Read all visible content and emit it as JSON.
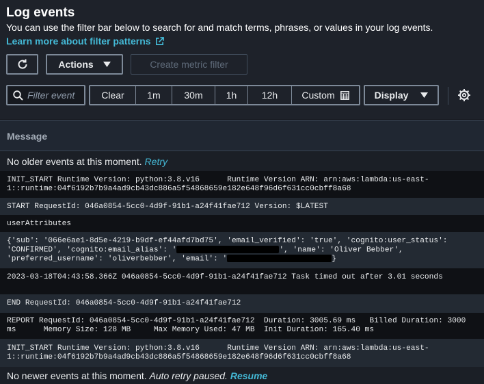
{
  "header": {
    "title": "Log events",
    "description": "You can use the filter bar below to search for and match terms, phrases, or values in your log events.",
    "learn_more": "Learn more about filter patterns"
  },
  "toolbar": {
    "refresh_icon": "refresh-icon",
    "actions_label": "Actions",
    "create_metric_filter_label": "Create metric filter"
  },
  "filter": {
    "placeholder": "Filter event",
    "clear_label": "Clear",
    "ranges": [
      "1m",
      "30m",
      "1h",
      "12h"
    ],
    "custom_label": "Custom",
    "display_label": "Display"
  },
  "table": {
    "column_message": "Message"
  },
  "status": {
    "no_older": "No older events at this moment.",
    "retry": "Retry",
    "no_newer": "No newer events at this moment.",
    "auto_retry": "Auto retry paused.",
    "resume": "Resume"
  },
  "logs": {
    "init1_l1": "INIT_START Runtime Version: python:3.8.v16      Runtime Version ARN: arn:aws:lambda:us-east-",
    "init1_l2": "1::runtime:04f6192b7b9a4ad9cb43dc886a5f54868659e182e648f96d6f631cc0cbff8a68",
    "start": "START RequestId: 046a0854-5cc0-4d9f-91b1-a24f41fae712 Version: $LATEST",
    "user_attrs": "userAttributes",
    "attrs_l1": "{'sub': '066e6ae1-8d5e-4219-b9df-ef44afd7bd75', 'email_verified': 'true', 'cognito:user_status':",
    "attrs_l2a": "'CONFIRMED', 'cognito:email_alias': '",
    "attrs_l2b": "', 'name': 'Oliver Bebber',",
    "attrs_l3a": "'preferred_username': 'oliverbebber', 'email': '",
    "attrs_l3b": "}",
    "timeout": "2023-03-18T04:43:58.366Z 046a0854-5cc0-4d9f-91b1-a24f41fae712 Task timed out after 3.01 seconds",
    "end": "END RequestId: 046a0854-5cc0-4d9f-91b1-a24f41fae712",
    "report_l1": "REPORT RequestId: 046a0854-5cc0-4d9f-91b1-a24f41fae712  Duration: 3005.69 ms   Billed Duration: 3000",
    "report_l2": "ms      Memory Size: 128 MB     Max Memory Used: 47 MB  Init Duration: 165.40 ms",
    "init2_l1": "INIT_START Runtime Version: python:3.8.v16      Runtime Version ARN: arn:aws:lambda:us-east-",
    "init2_l2": "1::runtime:04f6192b7b9a4ad9cb43dc886a5f54868659e182e648f96d6f631cc0cbff8a68"
  }
}
